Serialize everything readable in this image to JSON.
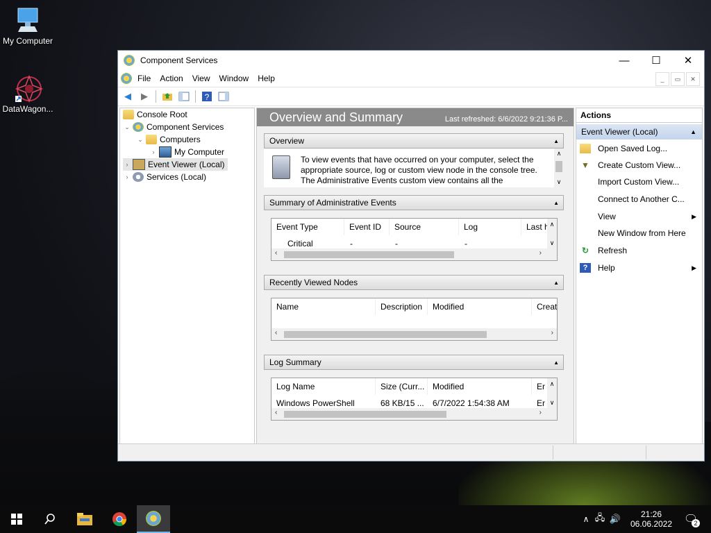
{
  "desktop": {
    "icons": [
      {
        "label": "My Computer"
      },
      {
        "label": "DataWagon..."
      }
    ]
  },
  "window": {
    "title": "Component Services",
    "controls": {
      "minimize": "—",
      "maximize": "☐",
      "close": "✕"
    },
    "menu": [
      "File",
      "Action",
      "View",
      "Window",
      "Help"
    ],
    "mdi": {
      "min": "_",
      "restore": "▭",
      "close": "✕"
    }
  },
  "tree": [
    {
      "label": "Console Root",
      "expander": "",
      "icon": "folder-icon"
    },
    {
      "label": "Component Services",
      "expander": "⌄",
      "icon": "component-services-icon"
    },
    {
      "label": "Computers",
      "expander": "⌄",
      "icon": "folder-icon"
    },
    {
      "label": "My Computer",
      "expander": "›",
      "icon": "computer-icon"
    },
    {
      "label": "Event Viewer (Local)",
      "expander": "›",
      "icon": "event-viewer-icon",
      "selected": true
    },
    {
      "label": "Services (Local)",
      "expander": "›",
      "icon": "services-icon"
    }
  ],
  "overview": {
    "heading": "Overview and Summary",
    "refreshed": "Last refreshed: 6/6/2022 9:21:36 P...",
    "sections": {
      "overview": {
        "title": "Overview",
        "text_line1": "To view events that have occurred on your computer, select the",
        "text_line2": "appropriate source, log or custom view node in the console tree.",
        "text_line3": "The Administrative Events custom view contains all the"
      },
      "admin": {
        "title": "Summary of Administrative Events",
        "columns": [
          "Event Type",
          "Event ID",
          "Source",
          "Log",
          "Last h"
        ],
        "row": [
          "Critical",
          "-",
          "-",
          "-"
        ]
      },
      "recent": {
        "title": "Recently Viewed Nodes",
        "columns": [
          "Name",
          "Description",
          "Modified",
          "Creat"
        ]
      },
      "logsum": {
        "title": "Log Summary",
        "columns": [
          "Log Name",
          "Size (Curr...",
          "Modified",
          "Er"
        ],
        "row": [
          "Windows PowerShell",
          "68 KB/15 ...",
          "6/7/2022 1:54:38 AM",
          "Er"
        ]
      }
    }
  },
  "actions": {
    "header": "Actions",
    "group": "Event Viewer (Local)",
    "items": [
      {
        "label": "Open Saved Log...",
        "icon": "open-folder-icon",
        "submenu": false
      },
      {
        "label": "Create Custom View...",
        "icon": "filter-icon",
        "submenu": false
      },
      {
        "label": "Import Custom View...",
        "icon": "",
        "submenu": false
      },
      {
        "label": "Connect to Another C...",
        "icon": "",
        "submenu": false
      },
      {
        "label": "View",
        "icon": "",
        "submenu": true
      },
      {
        "label": "New Window from Here",
        "icon": "",
        "submenu": false
      },
      {
        "label": "Refresh",
        "icon": "refresh-icon",
        "submenu": false
      },
      {
        "label": "Help",
        "icon": "help-icon",
        "submenu": true
      }
    ]
  },
  "taskbar": {
    "time": "21:26",
    "date": "06.06.2022",
    "notifications": "2"
  }
}
